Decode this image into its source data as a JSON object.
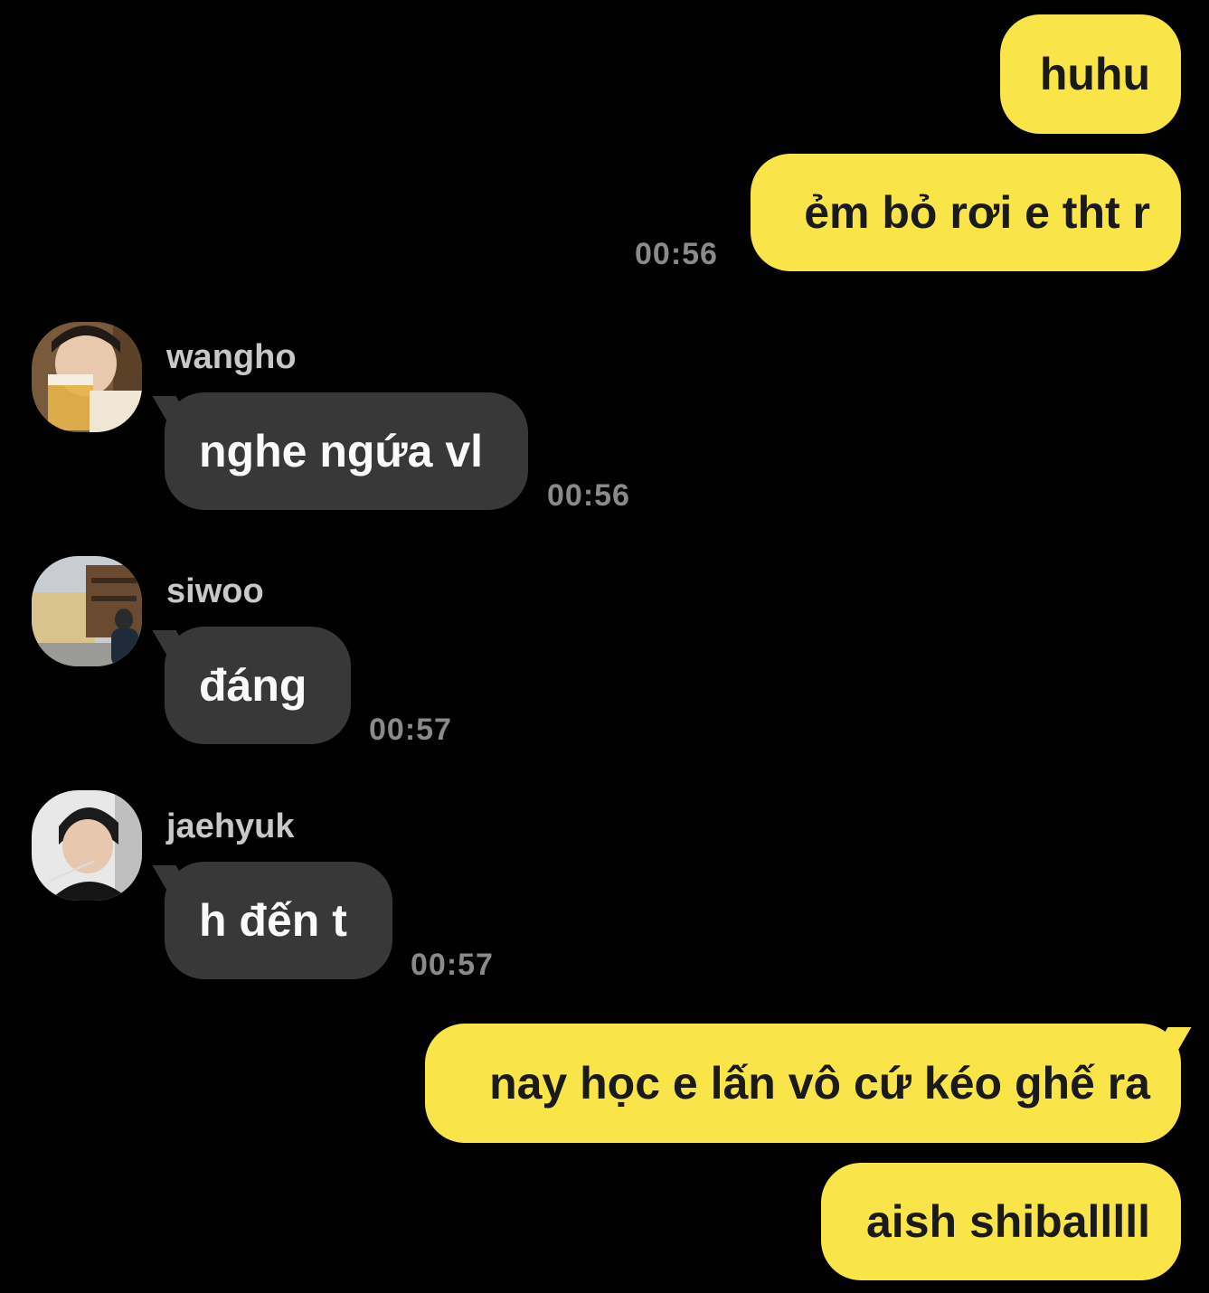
{
  "messages": [
    {
      "side": "out",
      "text": "huhu"
    },
    {
      "side": "out",
      "text": "ẻm bỏ rơi e tht r",
      "time": "00:56"
    },
    {
      "side": "in",
      "sender": "wangho",
      "text": "nghe ngứa vl",
      "time": "00:56"
    },
    {
      "side": "in",
      "sender": "siwoo",
      "text": "đáng",
      "time": "00:57"
    },
    {
      "side": "in",
      "sender": "jaehyuk",
      "text": "h đến t",
      "time": "00:57"
    },
    {
      "side": "out",
      "text": "nay học e lấn vô cứ kéo ghế ra"
    },
    {
      "side": "out",
      "text": "aish shiballlll"
    }
  ],
  "colors": {
    "outgoing_bubble": "#f9e547",
    "incoming_bubble": "#383838",
    "background": "#000000"
  }
}
